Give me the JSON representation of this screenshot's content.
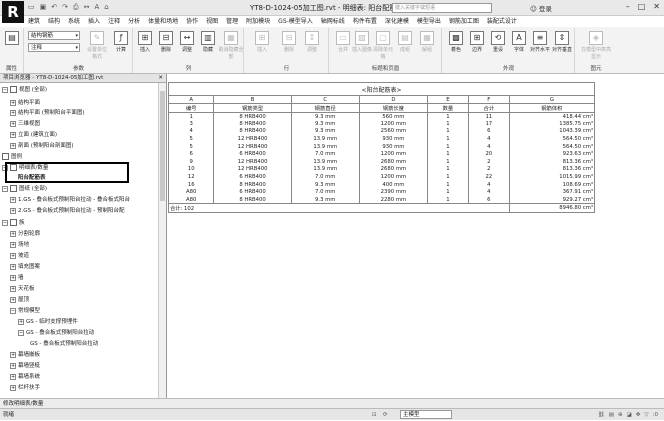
{
  "titlebar": {
    "logo": "R",
    "window_title": "YT8-D-1024-05加工图.rvt - 明细表: 阳台配筋表",
    "search_placeholder": "键入关键字或短语",
    "login": "登录",
    "qat_icons": [
      "open-icon",
      "save-icon",
      "undo-icon",
      "redo-icon",
      "print-icon",
      "measure-icon",
      "text-icon",
      "3d-icon"
    ]
  },
  "menu": {
    "items": [
      "建筑",
      "结构",
      "系统",
      "插入",
      "注释",
      "分析",
      "体量和场地",
      "协作",
      "视图",
      "管理",
      "附加模块",
      "GS-模型导入",
      "轴网标线",
      "构件布置",
      "深化建模",
      "模型导出",
      "钢筋加工图",
      "装配式设计"
    ]
  },
  "ribbon": {
    "properties_label": "属性",
    "params_combo1": "结构钢筋",
    "params_combo2": "注释",
    "params_buttons": [
      "设置单位格式",
      "计算"
    ],
    "params_label": "参数",
    "col_buttons": [
      "插入",
      "删除",
      "调整",
      "隐藏",
      "取消隐藏全部"
    ],
    "col_label": "列",
    "row_buttons": [
      "插入",
      "数据行",
      "删除",
      "调整"
    ],
    "row_label": "行",
    "title_buttons": [
      "合并",
      "取消合并",
      "插入图像",
      "清除单元格",
      "成组",
      "解组"
    ],
    "title_label": "标题和页眉",
    "appearance_buttons": [
      "着色",
      "边界",
      "重设",
      "字体",
      "对齐水平",
      "对齐垂直"
    ],
    "appearance_label": "外观",
    "element_button": "在模型中高亮显示",
    "element_label": "图元"
  },
  "browser": {
    "header": "项目浏览器 - YT8-D-1024-05加工图.rvt",
    "nodes": [
      {
        "tog": "−",
        "label": "视图 (全部)"
      },
      {
        "tog": "+",
        "label": "结构平面"
      },
      {
        "tog": "+",
        "label": "结构平面 (预制阳台平面图)"
      },
      {
        "tog": "+",
        "label": "三维视图"
      },
      {
        "tog": "+",
        "label": "立面 (建筑立面)"
      },
      {
        "tog": "+",
        "label": "剖面 (预制阳台剖面图)"
      },
      {
        "tog": "",
        "label": "图例"
      },
      {
        "tog": "−",
        "label": "明细表/数量"
      },
      {
        "tog": "",
        "label": "阳台配筋表"
      },
      {
        "tog": "−",
        "label": "图纸 (全部)"
      },
      {
        "tog": "+",
        "label": "1.GS - 叠合板式预制阳台拉动 - 叠合板式阳台"
      },
      {
        "tog": "+",
        "label": "2.GS - 叠合板式预制阳台拉动 - 预制阳台配"
      },
      {
        "tog": "−",
        "label": "族"
      },
      {
        "tog": "+",
        "label": "分割轮廓"
      },
      {
        "tog": "+",
        "label": "场地"
      },
      {
        "tog": "+",
        "label": "坡道"
      },
      {
        "tog": "+",
        "label": "填充图案"
      },
      {
        "tog": "+",
        "label": "墙"
      },
      {
        "tog": "+",
        "label": "天花板"
      },
      {
        "tog": "+",
        "label": "屋顶"
      },
      {
        "tog": "−",
        "label": "常规模型"
      },
      {
        "tog": "+",
        "label": "GS - 临时支撑预埋件"
      },
      {
        "tog": "−",
        "label": "GS - 叠合板式预制阳台拉动"
      },
      {
        "tog": "",
        "label": "GS - 叠合板式预制阳台拉动"
      },
      {
        "tog": "+",
        "label": "幕墙嵌板"
      },
      {
        "tog": "+",
        "label": "幕墙竖梃"
      },
      {
        "tog": "+",
        "label": "幕墙系统"
      },
      {
        "tog": "+",
        "label": "栏杆扶手"
      }
    ]
  },
  "schedule": {
    "title": "<阳台配筋表>",
    "letters": [
      "A",
      "B",
      "C",
      "D",
      "E",
      "F",
      "G"
    ],
    "headers": [
      "编号",
      "钢筋类型",
      "钢筋直径",
      "钢筋长度",
      "数量",
      "合计",
      "钢筋体积"
    ],
    "rows": [
      [
        "1",
        "8 HRB400",
        "9.3 mm",
        "560 mm",
        "1",
        "11",
        "418.44 cm³"
      ],
      [
        "3",
        "8 HRB400",
        "9.3 mm",
        "1200 mm",
        "1",
        "17",
        "1385.75 cm³"
      ],
      [
        "4",
        "8 HRB400",
        "9.3 mm",
        "2560 mm",
        "1",
        "6",
        "1043.39 cm³"
      ],
      [
        "5",
        "12 HRB400",
        "13.9 mm",
        "930 mm",
        "1",
        "4",
        "564.50 cm³"
      ],
      [
        "5",
        "12 HRB400",
        "13.9 mm",
        "930 mm",
        "1",
        "4",
        "564.50 cm³"
      ],
      [
        "6",
        "6 HRB400",
        "7.0 mm",
        "1200 mm",
        "1",
        "20",
        "923.63 cm³"
      ],
      [
        "9",
        "12 HRB400",
        "13.9 mm",
        "2680 mm",
        "1",
        "2",
        "813.36 cm³"
      ],
      [
        "10",
        "12 HRB400",
        "13.9 mm",
        "2680 mm",
        "1",
        "2",
        "813.36 cm³"
      ],
      [
        "12",
        "6 HRB400",
        "7.0 mm",
        "1200 mm",
        "1",
        "22",
        "1015.99 cm³"
      ],
      [
        "16",
        "8 HRB400",
        "9.3 mm",
        "400 mm",
        "1",
        "4",
        "108.69 cm³"
      ],
      [
        "A80",
        "6 HRB400",
        "7.0 mm",
        "2390 mm",
        "1",
        "4",
        "367.91 cm³"
      ],
      [
        "A80",
        "8 HRB400",
        "9.3 mm",
        "2280 mm",
        "1",
        "6",
        "929.27 cm³"
      ]
    ],
    "total_label": "合计: 102",
    "total_value": "8946.80 cm³"
  },
  "status": {
    "line1": "修改明细表/数量",
    "ready": "就绪",
    "model": "主模型",
    "bottom_icons": [
      "select-links-icon",
      "select-underlay-icon",
      "select-pinned-icon",
      "select-face-icon",
      "drag-icon",
      "filter-icon"
    ],
    "filter_count": ":0"
  }
}
